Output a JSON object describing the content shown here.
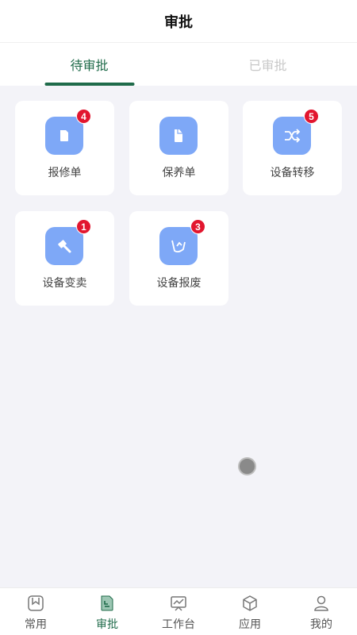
{
  "header": {
    "title": "审批"
  },
  "tabs": [
    {
      "label": "待审批",
      "active": true
    },
    {
      "label": "已审批",
      "active": false
    }
  ],
  "cards": [
    {
      "label": "报修单",
      "badge": "4",
      "icon": "document-icon"
    },
    {
      "label": "保养单",
      "badge": "",
      "icon": "clipboard-icon"
    },
    {
      "label": "设备转移",
      "badge": "5",
      "icon": "shuffle-icon"
    },
    {
      "label": "设备变卖",
      "badge": "1",
      "icon": "gavel-icon"
    },
    {
      "label": "设备报废",
      "badge": "3",
      "icon": "scrap-icon"
    }
  ],
  "tabbar": [
    {
      "label": "常用",
      "icon": "bookmark-icon",
      "active": false
    },
    {
      "label": "审批",
      "icon": "approval-icon",
      "active": true
    },
    {
      "label": "工作台",
      "icon": "workbench-icon",
      "active": false
    },
    {
      "label": "应用",
      "icon": "cube-icon",
      "active": false
    },
    {
      "label": "我的",
      "icon": "user-icon",
      "active": false
    }
  ],
  "colors": {
    "accent": "#1f6b4a",
    "icon_bg": "#7ea8f7",
    "badge": "#e2162f",
    "background": "#f3f3f8"
  }
}
